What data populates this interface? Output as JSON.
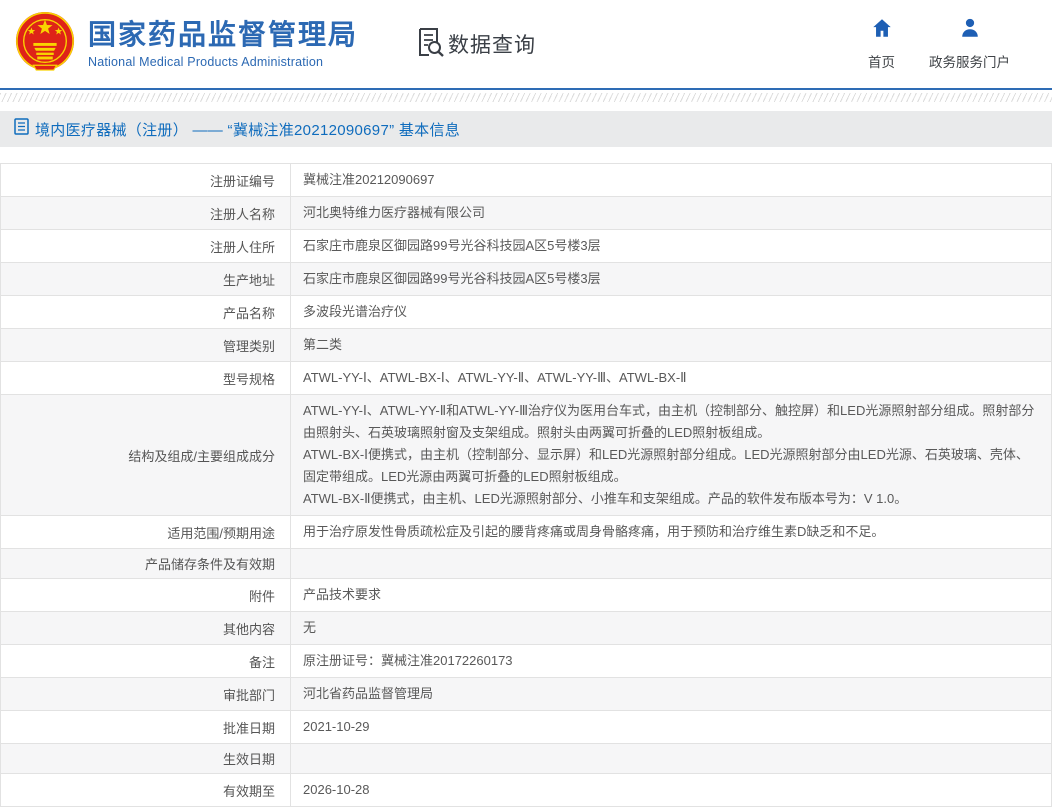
{
  "header": {
    "org_name_zh": "国家药品监督管理局",
    "org_name_en": "National Medical Products Administration",
    "data_query_label": "数据查询",
    "nav_home_label": "首页",
    "nav_portal_label": "政务服务门户"
  },
  "breadcrumb": {
    "text": "境内医疗器械（注册） —— “冀械注准20212090697” 基本信息"
  },
  "colors": {
    "brand_blue": "#2c69b3",
    "icon_blue": "#1e5fb4",
    "breadcrumb_link_blue": "#0f6cbd",
    "divider_blue": "#2e6cb5",
    "breadcrumb_bar_bg": "#e9eaeb",
    "row_alt_bg": "#f6f6f7",
    "table_border": "#e2e2e2",
    "emblem_red": "#de2318",
    "emblem_gold": "#f9d400",
    "text_dark": "#3a3f46",
    "table_text": "#595959"
  },
  "icons": {
    "logo": "national-emblem-icon",
    "data_query": "document-search-icon",
    "home": "home-icon",
    "portal": "person-icon",
    "breadcrumb": "document-list-icon"
  },
  "table": {
    "rows": [
      {
        "label": "注册证编号",
        "value": "冀械注准20212090697"
      },
      {
        "label": "注册人名称",
        "value": "河北奥特维力医疗器械有限公司"
      },
      {
        "label": "注册人住所",
        "value": "石家庄市鹿泉区御园路99号光谷科技园A区5号楼3层"
      },
      {
        "label": "生产地址",
        "value": "石家庄市鹿泉区御园路99号光谷科技园A区5号楼3层"
      },
      {
        "label": "产品名称",
        "value": "多波段光谱治疗仪"
      },
      {
        "label": "管理类别",
        "value": "第二类"
      },
      {
        "label": "型号规格",
        "value": "ATWL-YY-Ⅰ、ATWL-BX-Ⅰ、ATWL-YY-Ⅱ、ATWL-YY-Ⅲ、ATWL-BX-Ⅱ"
      },
      {
        "label": "结构及组成/主要组成成分",
        "value": [
          "ATWL-YY-Ⅰ、ATWL-YY-Ⅱ和ATWL-YY-Ⅲ治疗仪为医用台车式，由主机（控制部分、触控屏）和LED光源照射部分组成。照射部分由照射头、石英玻璃照射窗及支架组成。照射头由两翼可折叠的LED照射板组成。",
          "ATWL-BX-Ⅰ便携式，由主机（控制部分、显示屏）和LED光源照射部分组成。LED光源照射部分由LED光源、石英玻璃、壳体、固定带组成。LED光源由两翼可折叠的LED照射板组成。",
          "ATWL-BX-Ⅱ便携式，由主机、LED光源照射部分、小推车和支架组成。产品的软件发布版本号为：V 1.0。"
        ]
      },
      {
        "label": "适用范围/预期用途",
        "value": "用于治疗原发性骨质疏松症及引起的腰背疼痛或周身骨骼疼痛，用于预防和治疗维生素D缺乏和不足。"
      },
      {
        "label": "产品储存条件及有效期",
        "value": ""
      },
      {
        "label": "附件",
        "value": "产品技术要求"
      },
      {
        "label": "其他内容",
        "value": "无"
      },
      {
        "label": "备注",
        "value": "原注册证号：冀械注准20172260173"
      },
      {
        "label": "审批部门",
        "value": "河北省药品监督管理局"
      },
      {
        "label": "批准日期",
        "value": "2021-10-29"
      },
      {
        "label": "生效日期",
        "value": ""
      },
      {
        "label": "有效期至",
        "value": "2026-10-28"
      }
    ]
  }
}
